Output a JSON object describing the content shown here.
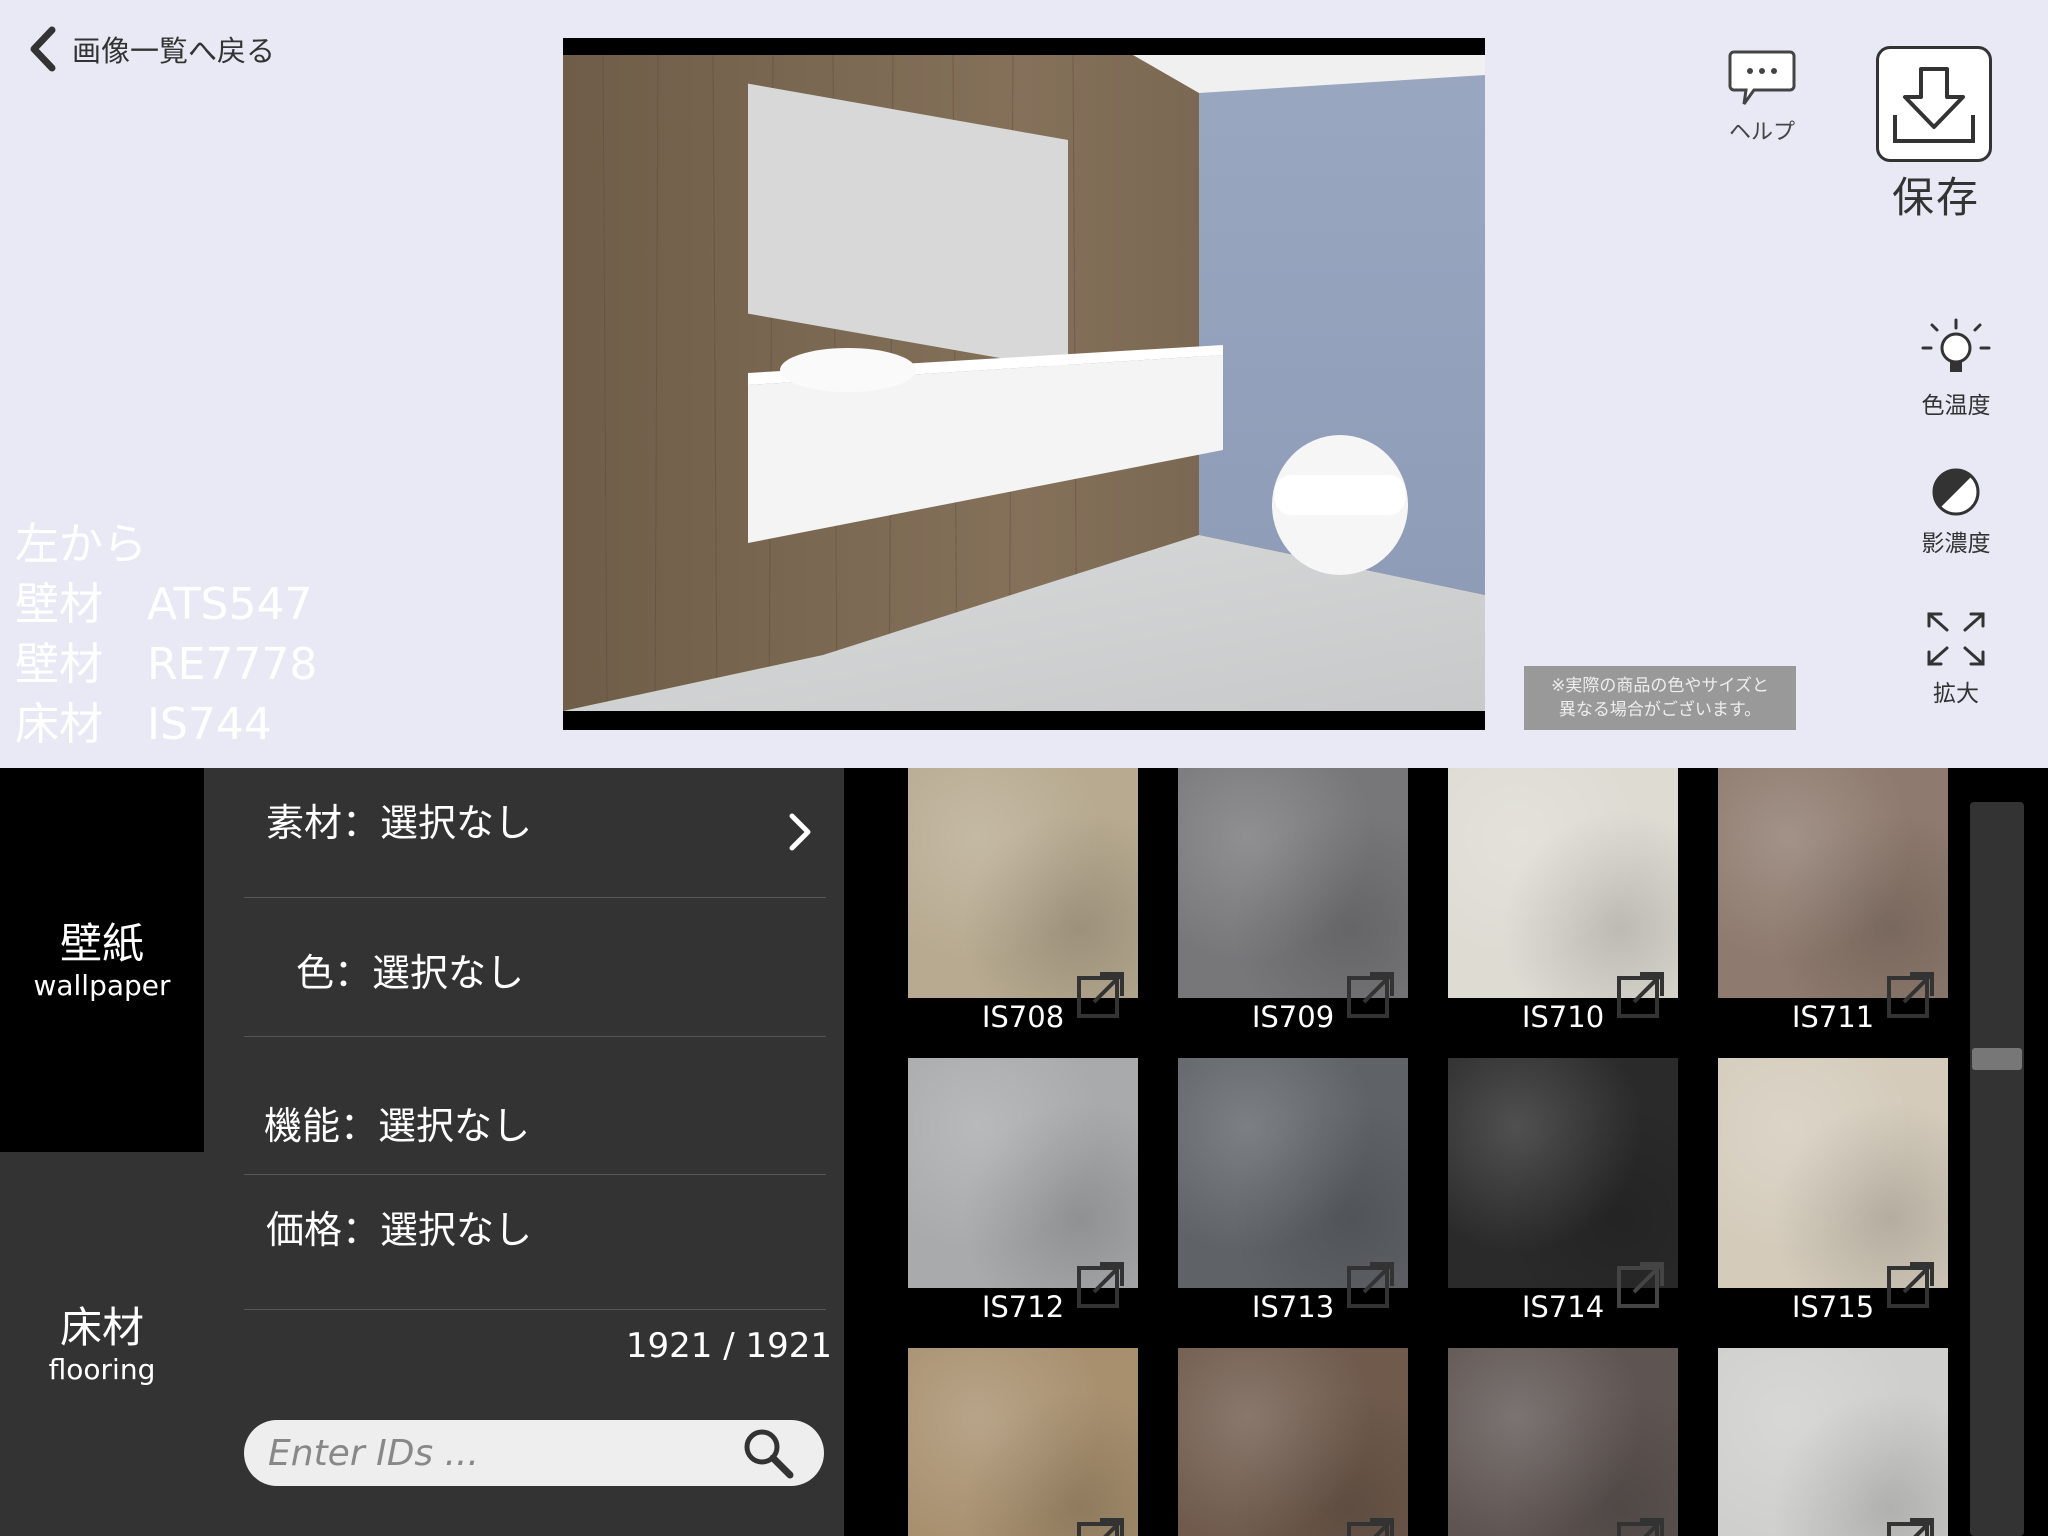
{
  "header": {
    "back_label": "画像一覧へ戻る"
  },
  "caption": {
    "lines": [
      "左から",
      "壁材　ATS547",
      "壁材　RE7778",
      "床材　IS744"
    ]
  },
  "toolbar": {
    "help_label": "ヘルプ",
    "save_label": "保存",
    "color_temp_label": "色温度",
    "shadow_label": "影濃度",
    "zoom_label": "拡大"
  },
  "notice": {
    "line1": "※実際の商品の色やサイズと",
    "line2": "異なる場合がございます。"
  },
  "categories": [
    {
      "jp": "壁紙",
      "en": "wallpaper"
    },
    {
      "jp": "床材",
      "en": "flooring"
    }
  ],
  "filters": [
    {
      "label": "素材：選択なし"
    },
    {
      "label": "色：選択なし"
    },
    {
      "label": "機能：選択なし"
    },
    {
      "label": "価格：選択なし"
    }
  ],
  "result_count": "1921 / 1921",
  "search": {
    "placeholder": "Enter IDs ..."
  },
  "tiles": [
    {
      "id": "IS708",
      "color": "#b7aa90"
    },
    {
      "id": "IS709",
      "color": "#77777a"
    },
    {
      "id": "IS710",
      "color": "#dddbd2"
    },
    {
      "id": "IS711",
      "color": "#8e7a6e"
    },
    {
      "id": "IS712",
      "color": "#a9aaab"
    },
    {
      "id": "IS713",
      "color": "#5f6368"
    },
    {
      "id": "IS714",
      "color": "#2a2a2b"
    },
    {
      "id": "IS715",
      "color": "#d4cbbb"
    },
    {
      "id": "",
      "color": "#a8906f"
    },
    {
      "id": "",
      "color": "#6f5a4c"
    },
    {
      "id": "",
      "color": "#5e5552"
    },
    {
      "id": "",
      "color": "#cfcfcd"
    }
  ]
}
